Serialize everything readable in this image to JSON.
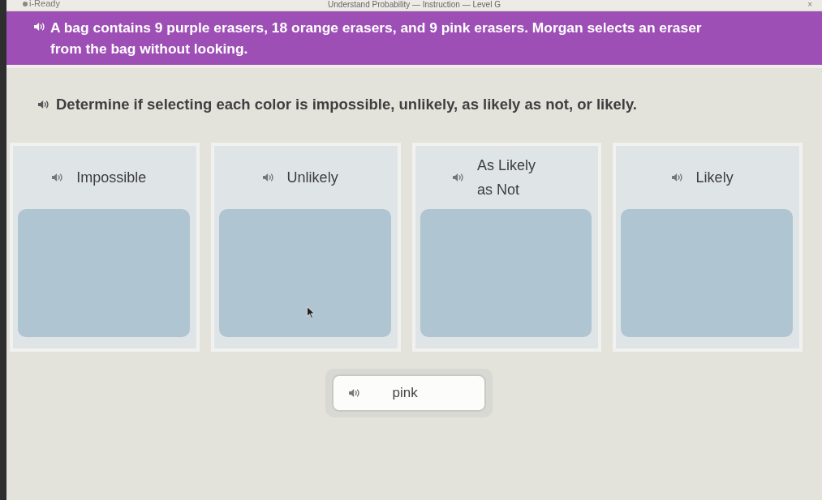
{
  "window": {
    "logo": "i-Ready",
    "title": "Understand Probability — Instruction — Level G",
    "close": "×"
  },
  "prompt": {
    "text": "A bag contains 9 purple erasers, 18 orange erasers, and 9 pink erasers. Morgan selects an eraser from the bag without looking."
  },
  "instruction": {
    "text": "Determine if selecting each color is impossible, unlikely, as likely as not, or likely."
  },
  "categories": [
    {
      "label": "Impossible"
    },
    {
      "label": "Unlikely"
    },
    {
      "label": "As Likely as Not"
    },
    {
      "label": "Likely"
    }
  ],
  "answer_choices": [
    {
      "label": "pink"
    }
  ]
}
